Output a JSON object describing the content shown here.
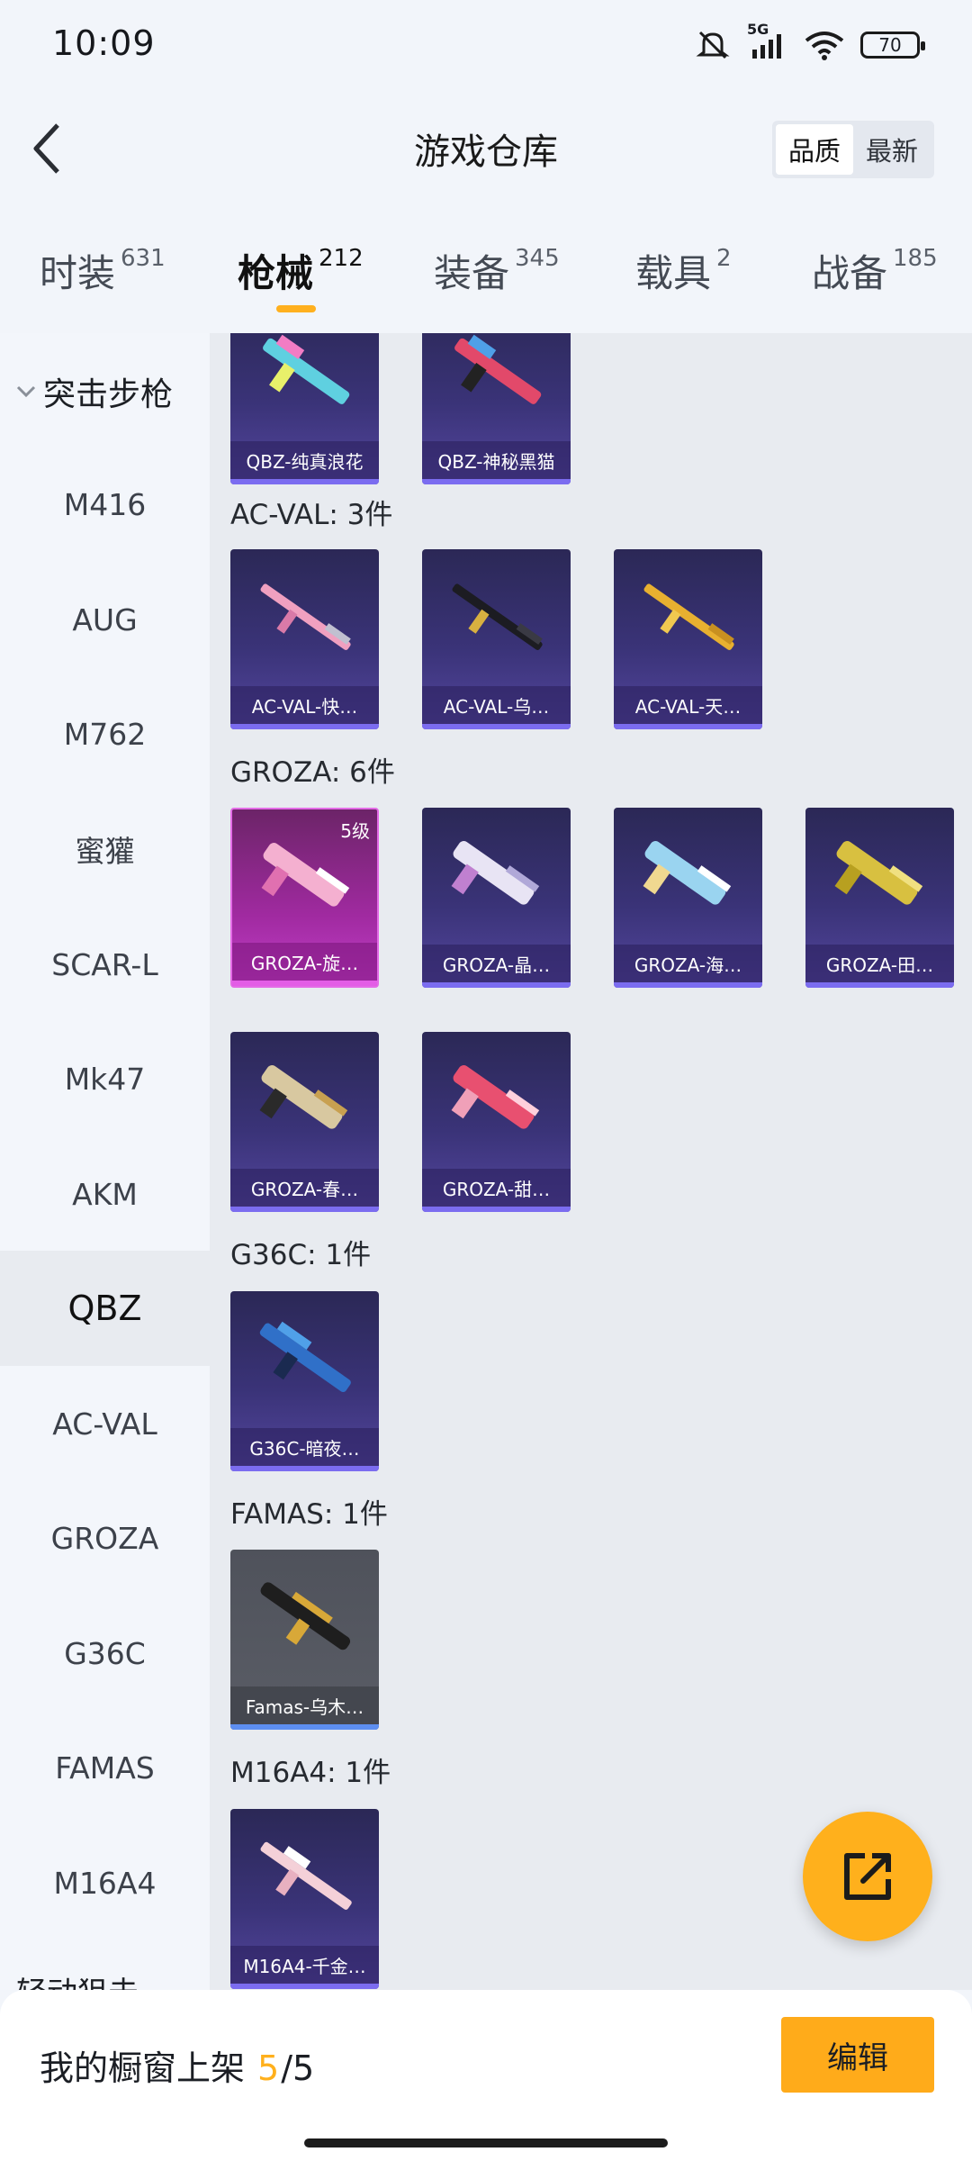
{
  "status_bar": {
    "time": "10:09",
    "network": "5G",
    "battery": "70"
  },
  "header": {
    "title": "游戏仓库",
    "sort_options": [
      "品质",
      "最新"
    ]
  },
  "category_tabs": [
    {
      "label": "时装",
      "count": "631"
    },
    {
      "label": "枪械",
      "count": "212"
    },
    {
      "label": "装备",
      "count": "345"
    },
    {
      "label": "载具",
      "count": "2"
    },
    {
      "label": "战备",
      "count": "185"
    }
  ],
  "sidebar": {
    "group_title": "突击步枪",
    "items": [
      "M416",
      "AUG",
      "M762",
      "蜜獾",
      "SCAR-L",
      "Mk47",
      "AKM",
      "QBZ",
      "AC-VAL",
      "GROZA",
      "G36C",
      "FAMAS",
      "M16A4"
    ],
    "active": "QBZ",
    "next_group_partial": "轻动狙击"
  },
  "sections": [
    {
      "label": "",
      "items": [
        {
          "name": "QBZ-纯真浪花"
        },
        {
          "name": "QBZ-神秘黑猫"
        }
      ]
    },
    {
      "label": "AC-VAL: 3件",
      "items": [
        {
          "name": "AC-VAL-快…"
        },
        {
          "name": "AC-VAL-乌…"
        },
        {
          "name": "AC-VAL-天…"
        }
      ]
    },
    {
      "label": "GROZA: 6件",
      "items": [
        {
          "name": "GROZA-旋…",
          "level": "5级"
        },
        {
          "name": "GROZA-晶…"
        },
        {
          "name": "GROZA-海…"
        },
        {
          "name": "GROZA-田…"
        },
        {
          "name": "GROZA-春…"
        },
        {
          "name": "GROZA-甜…"
        }
      ]
    },
    {
      "label": "G36C: 1件",
      "items": [
        {
          "name": "G36C-暗夜…"
        }
      ]
    },
    {
      "label": "FAMAS: 1件",
      "items": [
        {
          "name": "Famas-乌木…"
        }
      ]
    },
    {
      "label": "M16A4: 1件",
      "items": [
        {
          "name": "M16A4-千金…"
        }
      ]
    }
  ],
  "bottom_bar": {
    "label": "我的橱窗上架",
    "current": "5",
    "slash": "/",
    "total": "5",
    "edit": "编辑"
  },
  "colors": {
    "accent": "#ffb01c",
    "card_purple": "#3a3378",
    "card_pink": "#c23ec8"
  },
  "icons": {
    "share": "share-external-icon",
    "back": "back-arrow-icon"
  }
}
